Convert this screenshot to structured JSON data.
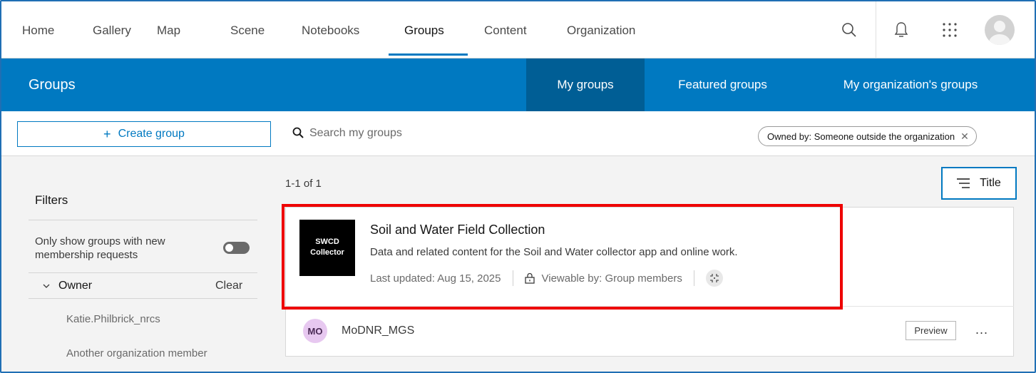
{
  "nav": {
    "items": [
      "Home",
      "Gallery",
      "Map",
      "Scene",
      "Notebooks",
      "Groups",
      "Content",
      "Organization"
    ],
    "active": "Groups",
    "icons": [
      "search-icon",
      "bell-icon",
      "app-launcher-icon",
      "user-avatar-icon"
    ]
  },
  "header": {
    "title": "Groups",
    "tabs": [
      "My groups",
      "Featured groups",
      "My organization's groups"
    ],
    "active_tab": "My groups",
    "accent_color": "#0079c1",
    "active_tab_color": "#005e95"
  },
  "toolbar": {
    "create_label": "Create group",
    "search_placeholder": "Search my groups",
    "filter_chip": "Owned by: Someone outside the organization"
  },
  "sidebar": {
    "filters_title": "Filters",
    "toggle_label": "Only show groups with new membership requests",
    "owner_heading": "Owner",
    "clear_label": "Clear",
    "owner_options": [
      "Katie.Philbrick_nrcs",
      "Another organization member"
    ]
  },
  "results": {
    "count": "1-1 of 1",
    "sort_label": "Title",
    "group": {
      "thumbnail_line1": "SWCD",
      "thumbnail_line2": "Collector",
      "title": "Soil and Water Field Collection",
      "description": "Data and related content for the Soil and Water collector app and online work.",
      "last_updated": "Last updated: Aug 15, 2025",
      "viewable": "Viewable by: Group members",
      "owner_initials": "MO",
      "owner_name": "MoDNR_MGS",
      "preview_label": "Preview",
      "more_label": "..."
    }
  },
  "highlight_color": "#ee0000"
}
